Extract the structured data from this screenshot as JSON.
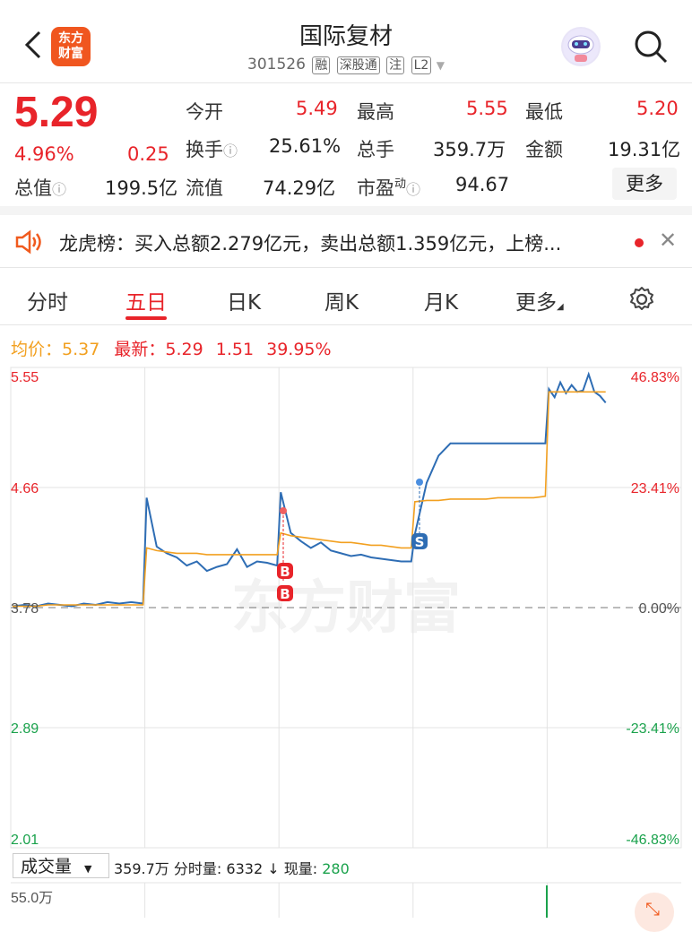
{
  "header": {
    "title": "国际复材",
    "logo_text_1": "东方",
    "logo_text_2": "财富",
    "code": "301526",
    "tags": [
      "融",
      "深股通",
      "注",
      "L2"
    ]
  },
  "quote": {
    "price": "5.29",
    "change_pct": "4.96%",
    "change": "0.25",
    "rows": [
      {
        "l1": "今开",
        "v1": "5.49",
        "l2": "最高",
        "v2": "5.55",
        "l3": "最低",
        "v3": "5.20"
      },
      {
        "l1": "换手",
        "v1": "25.61%",
        "l2": "总手",
        "v2": "359.7万",
        "l3": "金额",
        "v3": "19.31亿"
      },
      {
        "l1": "流值",
        "v1": "74.29亿",
        "l2": "市盈",
        "v2": "94.67"
      }
    ],
    "total_value_label": "总值",
    "total_value": "199.5亿",
    "pe_sup": "动",
    "more": "更多"
  },
  "notice": {
    "text": "龙虎榜：买入总额2.279亿元，卖出总额1.359亿元，上榜..."
  },
  "tabs": [
    "分时",
    "五日",
    "日K",
    "周K",
    "月K",
    "更多"
  ],
  "active_tab": 1,
  "legend": {
    "avg_label": "均价：",
    "avg_value": "5.37",
    "latest_label": "最新：",
    "latest_value": "5.29",
    "change": "1.51",
    "change_pct": "39.95%"
  },
  "chart_data": {
    "type": "line",
    "y_labels_left": [
      "5.55",
      "4.66",
      "3.78",
      "2.89",
      "2.01"
    ],
    "y_labels_right": [
      "46.83%",
      "23.41%",
      "0.00%",
      "-23.41%",
      "-46.83%"
    ],
    "ylim": [
      2.01,
      5.55
    ],
    "base": 3.78,
    "days": 5,
    "series": [
      {
        "name": "price",
        "color": "#2e6db4",
        "values": [
          3.79,
          3.8,
          3.79,
          3.81,
          3.8,
          3.79,
          3.81,
          3.8,
          3.82,
          3.81,
          3.82,
          3.81,
          4.59,
          4.23,
          4.18,
          4.15,
          4.09,
          4.12,
          4.05,
          4.08,
          4.1,
          4.21,
          4.08,
          4.12,
          4.11,
          4.09,
          4.63,
          4.33,
          4.27,
          4.22,
          4.26,
          4.2,
          4.18,
          4.16,
          4.17,
          4.15,
          4.14,
          4.13,
          4.12,
          4.12,
          4.32,
          4.7,
          4.9,
          4.99,
          4.99,
          4.99,
          4.99,
          4.99,
          4.99,
          4.99,
          4.99,
          4.99,
          5.39,
          5.33,
          5.44,
          5.36,
          5.42,
          5.37,
          5.38,
          5.5,
          5.37,
          5.34,
          5.29
        ]
      },
      {
        "name": "avg",
        "color": "#f2a020",
        "values": [
          3.79,
          3.79,
          3.79,
          3.8,
          3.8,
          3.8,
          3.8,
          3.8,
          3.8,
          3.8,
          3.8,
          3.8,
          4.22,
          4.2,
          4.19,
          4.18,
          4.18,
          4.18,
          4.17,
          4.17,
          4.17,
          4.17,
          4.17,
          4.17,
          4.17,
          4.17,
          4.33,
          4.31,
          4.3,
          4.29,
          4.28,
          4.27,
          4.26,
          4.26,
          4.25,
          4.24,
          4.24,
          4.23,
          4.22,
          4.22,
          4.56,
          4.57,
          4.57,
          4.58,
          4.58,
          4.58,
          4.58,
          4.59,
          4.59,
          4.59,
          4.59,
          4.6,
          5.37,
          5.37,
          5.37,
          5.37,
          5.37,
          5.37,
          5.37,
          5.37,
          5.37,
          5.37,
          5.37
        ]
      }
    ],
    "markers": [
      "B",
      "B",
      "S"
    ]
  },
  "volume": {
    "select_label": "成交量",
    "total": "359.7万",
    "period_label": "分时量:",
    "period_value": "6332",
    "now_label": "现量:",
    "now_value": "280",
    "arrow": "↓",
    "axis_top": "55.0万"
  },
  "watermark": "东方财富",
  "colors": {
    "up": "#e8242a",
    "down": "#1aa24c",
    "line": "#2e6db4",
    "avg": "#f2a020"
  }
}
